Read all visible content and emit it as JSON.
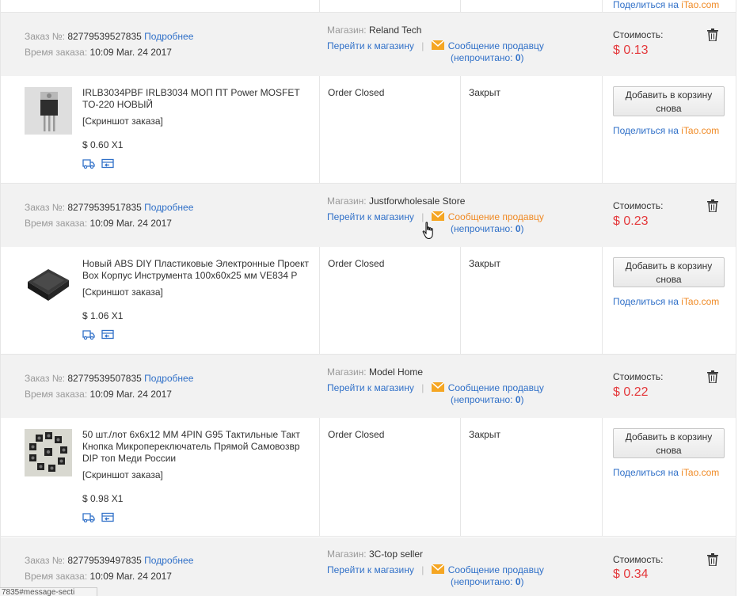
{
  "top_partial": {
    "share_prefix": "Поделиться на",
    "share_brand": "iTao.com"
  },
  "labels": {
    "order_no": "Заказ №:",
    "order_time": "Время заказа:",
    "details": "Подробнее",
    "store": "Магазин:",
    "goto_store": "Перейти к магазину",
    "separator": "|",
    "message_seller": "Сообщение продавцу",
    "unread_open": "(непрочитано: ",
    "unread_close": ")",
    "cost": "Стоимость:",
    "screenshot": "[Скриншот заказа]",
    "readd_line1": "Добавить в корзину",
    "readd_line2": "снова",
    "share_prefix": "Поделиться на",
    "share_brand": "iTao.com"
  },
  "orders": [
    {
      "order_number": "82779539527835",
      "order_time": "10:09 Mar. 24 2017",
      "store_name": "Reland Tech",
      "unread": "0",
      "cost": "$ 0.13",
      "product_title": "IRLB3034PBF IRLB3034 МОП ПТ Power MOSFET TO-220 НОВЫЙ",
      "product_price": "$ 0.60 X1",
      "order_status": "Order Closed",
      "status_ru": "Закрыт",
      "thumb_icon": "mosfet-transistor-image"
    },
    {
      "order_number": "82779539517835",
      "order_time": "10:09 Mar. 24 2017",
      "store_name": "Justforwholesale Store",
      "unread": "0",
      "cost": "$ 0.23",
      "product_title": "Новый ABS DIY Пластиковые Электронные Проект Box Корпус Инструмента 100x60x25 мм VE834 P",
      "product_price": "$ 1.06 X1",
      "order_status": "Order Closed",
      "status_ru": "Закрыт",
      "thumb_icon": "black-plastic-box-image"
    },
    {
      "order_number": "82779539507835",
      "order_time": "10:09 Mar. 24 2017",
      "store_name": "Model Home",
      "unread": "0",
      "cost": "$ 0.22",
      "product_title": "50 шт./лот 6x6x12 ММ 4PIN G95 Тактильные Такт Кнопка Микропереключатель Прямой Самовозвр DIP топ Меди России",
      "product_price": "$ 0.98 X1",
      "order_status": "Order Closed",
      "status_ru": "Закрыт",
      "thumb_icon": "tact-buttons-image"
    },
    {
      "order_number": "82779539497835",
      "order_time": "10:09 Mar. 24 2017",
      "store_name": "3C-top seller",
      "unread": "0",
      "cost": "$ 0.34"
    }
  ],
  "status_bar": {
    "url": "7835#message-secti"
  },
  "colors": {
    "link": "#3070c8",
    "price": "#e4393c",
    "hover": "#f08a24",
    "header_bg": "#f2f2f2"
  }
}
